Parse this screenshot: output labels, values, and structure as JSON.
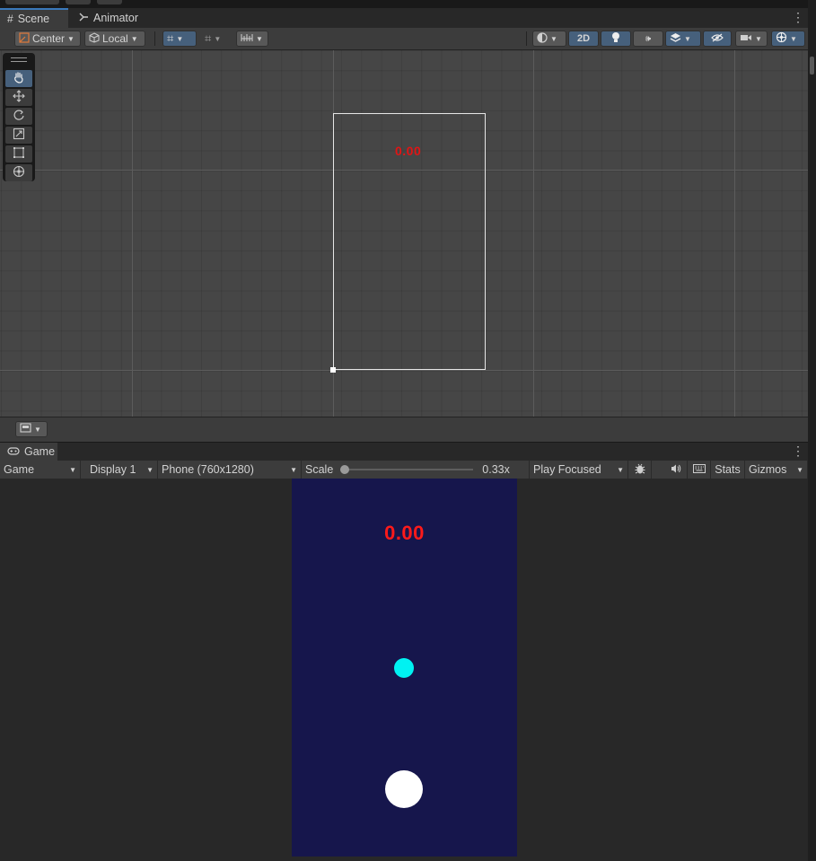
{
  "scene_panel": {
    "tabs": [
      {
        "label": "Scene",
        "icon": "grid-icon"
      },
      {
        "label": "Animator",
        "icon": "animator-icon"
      }
    ],
    "toolbar": {
      "pivot_mode": "Center",
      "pivot_rotation": "Local",
      "mode_2d": "2D"
    },
    "score_text": "0.00"
  },
  "game_panel": {
    "tab": {
      "label": "Game",
      "icon": "gamepad-icon"
    },
    "toolbar": {
      "view": "Game",
      "display": "Display 1",
      "resolution": "Phone (760x1280)",
      "scale_label": "Scale",
      "scale_value": "0.33x",
      "scale_fraction": 0.0,
      "play_mode": "Play Focused",
      "stats": "Stats",
      "gizmos": "Gizmos"
    },
    "score_text": "0.00",
    "colors": {
      "background": "#16164c",
      "score": "#ff1a1a",
      "small_ball": "#00f2f2",
      "large_ball": "#ffffff"
    }
  }
}
